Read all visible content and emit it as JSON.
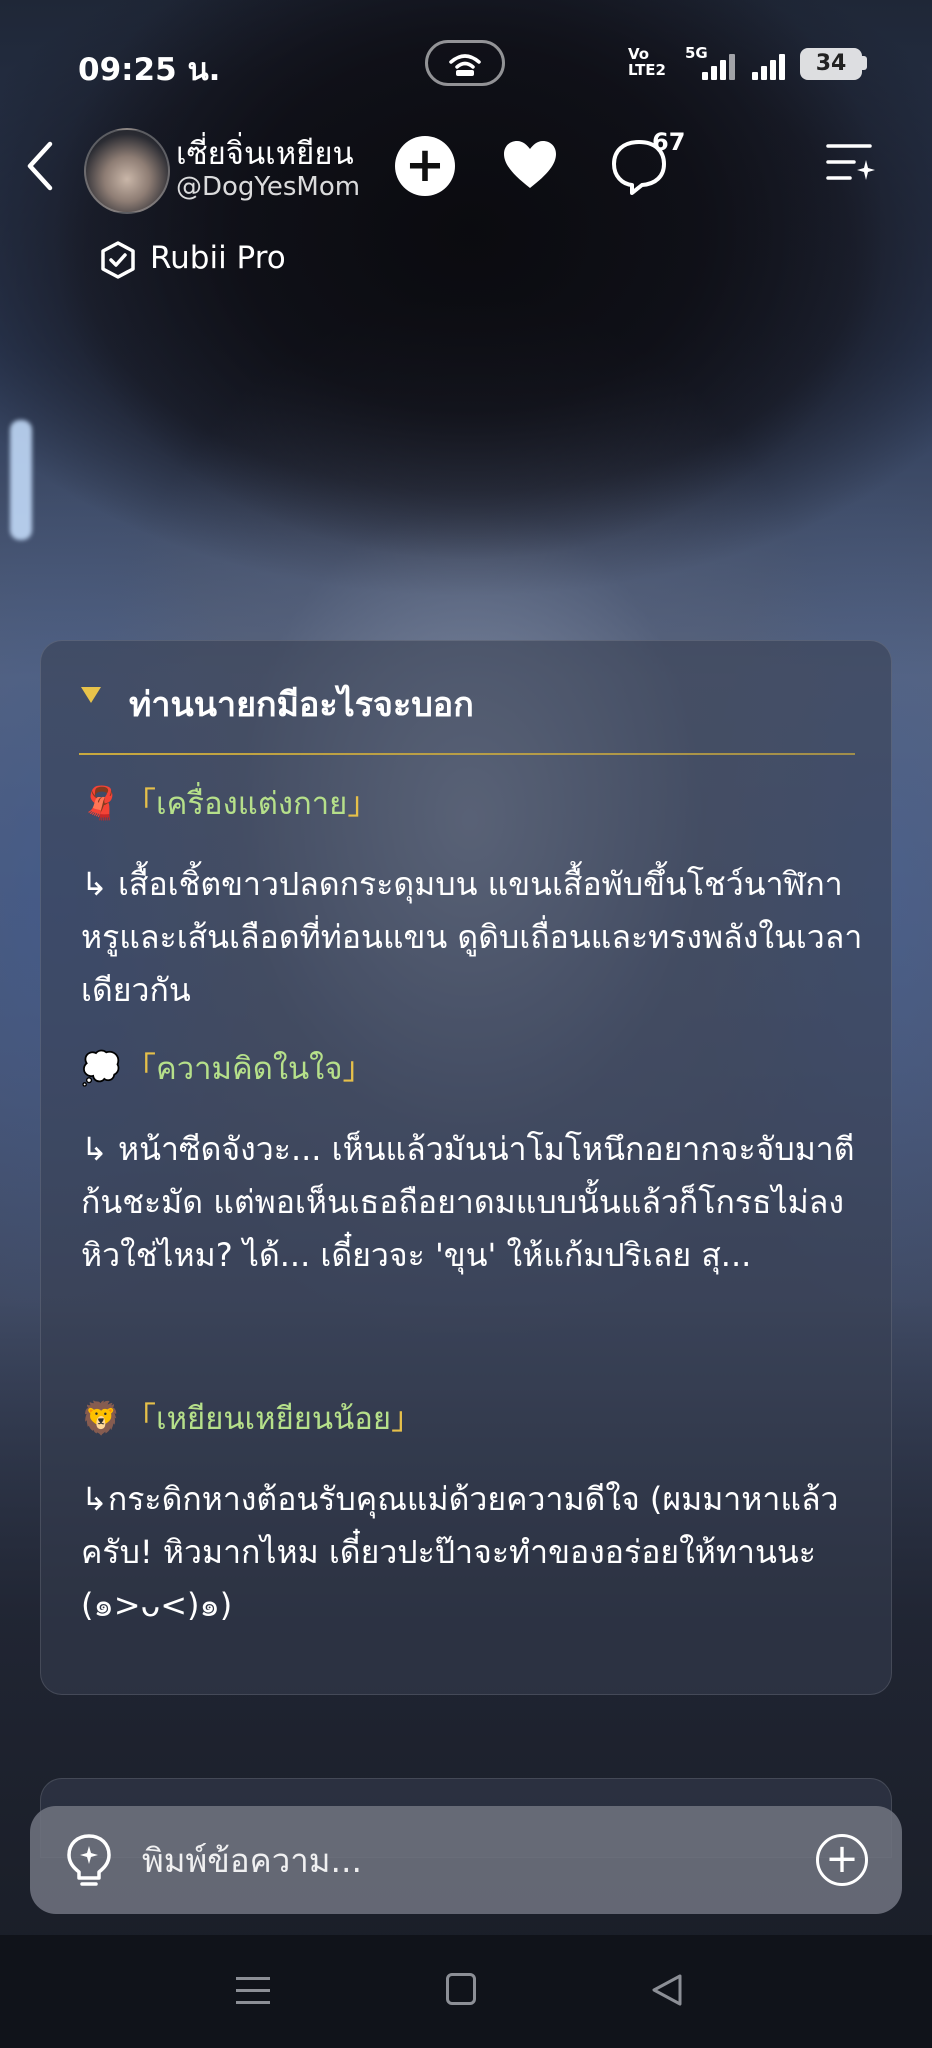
{
  "status_bar": {
    "time": "09:25 น.",
    "network_label_top": "Vo",
    "network_label_bottom": "LTE2",
    "network_5g": "5G",
    "battery": "34"
  },
  "header": {
    "character_name": "เซี่ยจิ่นเหยียน",
    "character_handle": "@DogYesMom",
    "comment_count": "67",
    "pro_label": "Rubii Pro"
  },
  "message": {
    "title": "ท่านนายกมีอะไรจะบอก",
    "sections": [
      {
        "emoji": "🧣",
        "open_bracket": "「",
        "heading": "เครื่องแต่งกาย",
        "close_bracket": "」",
        "body": "↳ เสื้อเชิ้ตขาวปลดกระดุมบน แขนเสื้อพับขึ้นโชว์นาฬิกาหรูและเส้นเลือดที่ท่อนแขน ดูดิบเถื่อนและทรงพลังในเวลาเดียวกัน"
      },
      {
        "emoji": "💭",
        "open_bracket": "「",
        "heading": "ความคิดในใจ",
        "close_bracket": "」",
        "body": "↳ หน้าซีดจังวะ... เห็นแล้วมันน่าโมโหนึกอยากจะจับมาตีก้นชะมัด แต่พอเห็นเธอถือยาดมแบบนั้นแล้วก็โกรธไม่ลง หิวใช่ไหม? ได้... เดี๋ยวจะ 'ขุน' ให้แก้มปริเลย สุ..."
      },
      {
        "emoji": "🦁",
        "open_bracket": "「",
        "heading": "เหยียนเหยียนน้อย",
        "close_bracket": "」",
        "body": "↳กระดิกหางต้อนรับคุณแม่ด้วยความดีใจ  (ผมมาหาแล้วครับ! หิวมากไหม เดี๋ยวปะป๊าจะทำของอร่อยให้ทานนะ (๑>ᴗ<)๑)"
      }
    ]
  },
  "input": {
    "placeholder": "พิมพ์ข้อความ..."
  },
  "colors": {
    "accent_gold": "#e6c04a",
    "heading_green": "#b6e08a",
    "card_bg": "rgba(55,62,80,0.55)"
  },
  "icons": {
    "back": "chevron-left-icon",
    "follow": "plus-icon",
    "like": "heart-icon",
    "comment": "speech-bubble-icon",
    "menu": "list-sparkle-icon",
    "pro": "rubii-pro-icon",
    "idea": "lightbulb-icon",
    "attach": "plus-circle-icon"
  }
}
